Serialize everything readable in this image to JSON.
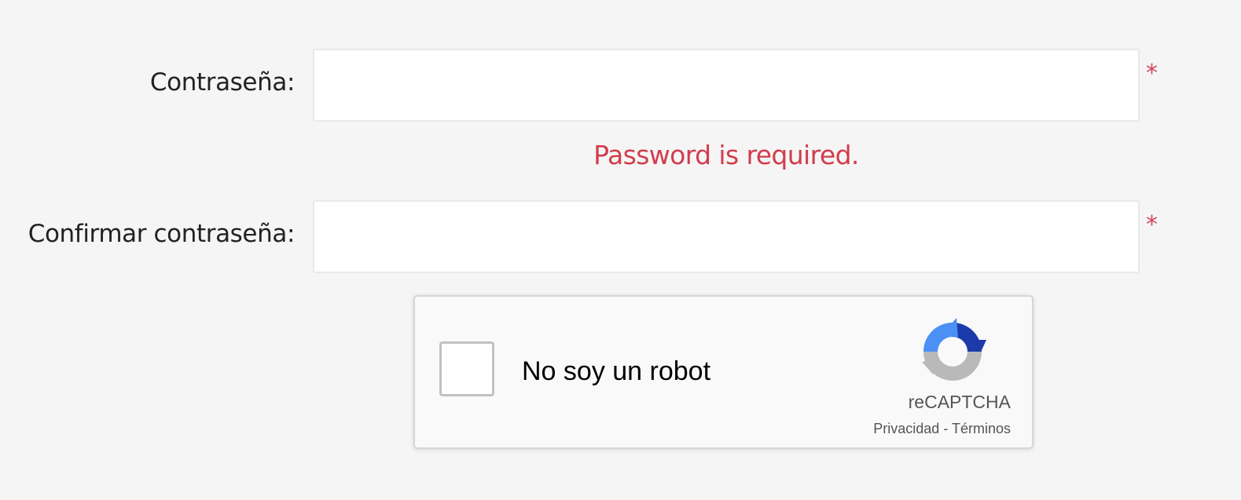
{
  "form": {
    "password": {
      "label": "Contraseña:",
      "value": "",
      "required_mark": "*",
      "error": "Password is required."
    },
    "confirm_password": {
      "label": "Confirmar contraseña:",
      "value": "",
      "required_mark": "*"
    }
  },
  "recaptcha": {
    "checkbox_label": "No soy un robot",
    "checked": false,
    "brand": "reCAPTCHA",
    "privacy_link": "Privacidad",
    "separator": " - ",
    "terms_link": "Términos",
    "icon": "recaptcha-logo-icon"
  },
  "colors": {
    "background": "#f5f5f5",
    "error": "#d23c4c",
    "required": "#d9455b",
    "recaptcha_blue_dark": "#1c3aa9",
    "recaptcha_blue_light": "#4a90f5",
    "recaptcha_gray": "#b9b9b9"
  }
}
